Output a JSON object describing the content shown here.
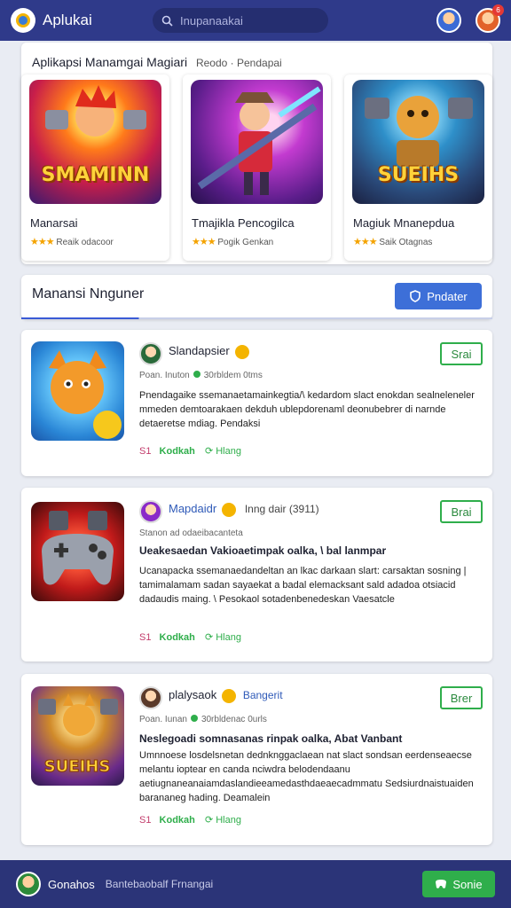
{
  "header": {
    "title": "Aplukai",
    "search_placeholder": "Inupanaakai",
    "notification_count": "6"
  },
  "featured": {
    "title": "Aplikapsi Manamgai Magiari",
    "subtitle": "Reodo · Pendapai",
    "cards": [
      {
        "title": "Manarsai",
        "art_text": "SMAMINN",
        "rating_stars": "★★★",
        "rating_text": "Reaik odacoor"
      },
      {
        "title": "Tmajikla Pencogilca",
        "art_text": "",
        "rating_stars": "★★★",
        "rating_text": "Pogik Genkan"
      },
      {
        "title": "Magiuk Mnanepdua",
        "art_text": "SUEIHS",
        "rating_stars": "★★★",
        "rating_text": "Saik Otagnas"
      }
    ]
  },
  "section": {
    "title": "Manansi Nnguner",
    "filter_label": "Pndater"
  },
  "posts": [
    {
      "username": "Slandapsier",
      "meta_left": "Poan. Inuton",
      "meta_right": "30rbldem 0tms",
      "headline": "",
      "description": "Pnendagaike ssemanaetamainkegtia/\\ kedardom slact enokdan sealneleneler mmeden demtoarakaen dekduh ublepdorenaml deonubebrer di narnde detaeretse mdiag. Pendaksi",
      "action_count": "S1",
      "action_like": "Kodkah",
      "action_share": "Hlang",
      "get_label": "Srai"
    },
    {
      "username": "Mapdaidr",
      "username_extra": "Inng dair  (3911)",
      "meta_left": "Stanon ad odaeibacanteta",
      "meta_right": "",
      "headline": "Ueakesaedan Vakioaetimpak oalka, \\ bal lanmpar",
      "description": "Ucanapacka ssemanaedandeltan an  lkac darkaan slart: carsaktan sosning | tamimalamam sadan sayaekat a badal elemacksant sald adadoa otsiacid dadaudis maing. \\ Pesokaol sotadenbenedeskan Vaesatcle",
      "action_count": "S1",
      "action_like": "Kodkah",
      "action_share": "Hlang",
      "get_label": "Brai"
    },
    {
      "username": "plalysaok",
      "username_extra": "Bangerit",
      "meta_left": "Poan. Iunan",
      "meta_right": "30rbldenac 0urls",
      "headline": "Neslegoadi somnasanas rinpak oalka, Abat Vanbant",
      "description": "Umnnoese losdelsnetan dednknggaclaean nat slact sondsan eerdenseaecse melantu ioptear en canda nciwdra belodendaanu aetiugnaneanaiamdaslandieeamedasthdaeaecadmmatu Sedsiurdnaistuaiden barananeg hading. Deamalein",
      "action_count": "S1",
      "action_like": "Kodkah",
      "action_share": "Hlang",
      "get_label": "Brer"
    }
  ],
  "bottom_bar": {
    "name": "Gonahos",
    "status": "Bantebaobalf Frnangai",
    "send_label": "Sonie"
  },
  "colors": {
    "topbar": "#2f3a8a",
    "accent_blue": "#3d6fd8",
    "accent_green": "#2fae4b",
    "star": "#f4a300"
  }
}
